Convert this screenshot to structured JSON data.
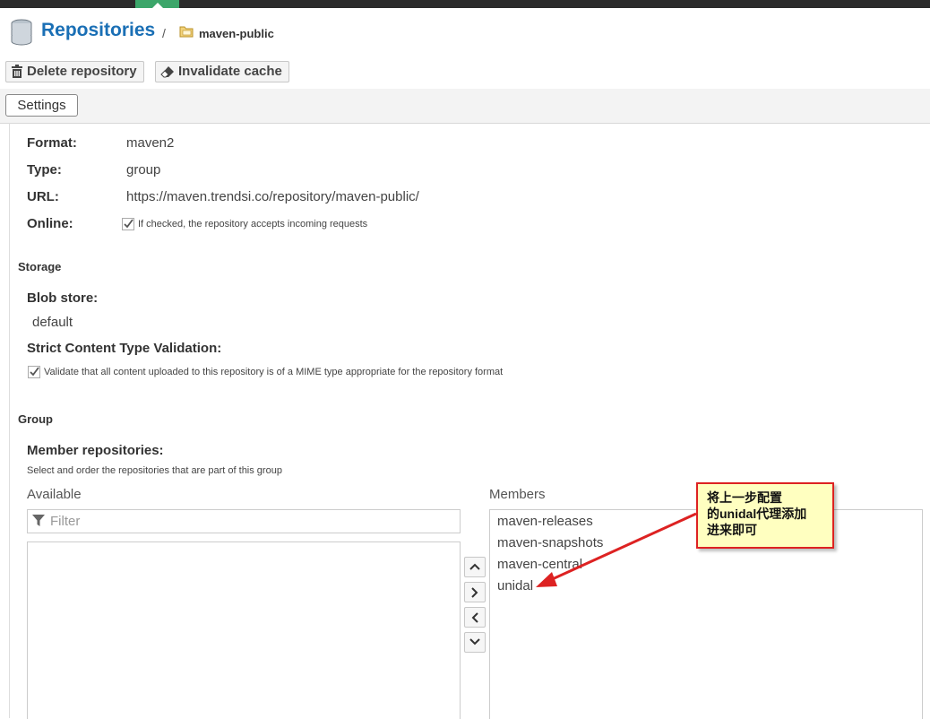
{
  "header": {
    "title": "Repositories",
    "separator": "/",
    "repo_name": "maven-public"
  },
  "toolbar": {
    "delete_label": "Delete repository",
    "invalidate_label": "Invalidate cache"
  },
  "tabs": {
    "settings_label": "Settings"
  },
  "details": {
    "format_label": "Format:",
    "format_value": "maven2",
    "type_label": "Type:",
    "type_value": "group",
    "url_label": "URL:",
    "url_value": "https://maven.trendsi.co/repository/maven-public/",
    "online_label": "Online:",
    "online_help": "If checked, the repository accepts incoming requests",
    "online_checked": true
  },
  "storage": {
    "section_title": "Storage",
    "blob_label": "Blob store:",
    "blob_value": "default",
    "strict_label": "Strict Content Type Validation:",
    "strict_help": "Validate that all content uploaded to this repository is of a MIME type appropriate for the repository format",
    "strict_checked": true
  },
  "group": {
    "section_title": "Group",
    "members_label": "Member repositories:",
    "members_help": "Select and order the repositories that are part of this group",
    "available_title": "Available",
    "filter_placeholder": "Filter",
    "members_title": "Members",
    "members": [
      "maven-releases",
      "maven-snapshots",
      "maven-central",
      "unidal"
    ]
  },
  "annotation": {
    "lines": [
      "将上一步配置",
      "的unidal代理添加",
      "进来即可"
    ],
    "border_color": "#dd2222",
    "fill_color": "#ffffc0"
  },
  "colors": {
    "accent": "#1a6fb5",
    "top_tab": "#3ca66a"
  }
}
